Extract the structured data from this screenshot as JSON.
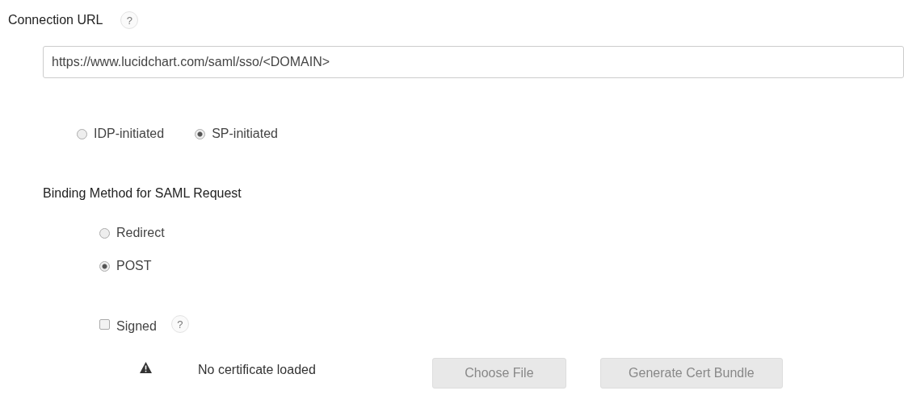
{
  "connection_url": {
    "label": "Connection URL",
    "help": "?",
    "value": "https://www.lucidchart.com/saml/sso/<DOMAIN>"
  },
  "initiation": [
    {
      "label": "IDP-initiated",
      "selected": false
    },
    {
      "label": "SP-initiated",
      "selected": true
    }
  ],
  "binding": {
    "label": "Binding Method for SAML Request",
    "options": [
      {
        "label": "Redirect",
        "selected": false
      },
      {
        "label": "POST",
        "selected": true
      }
    ]
  },
  "signed": {
    "label": "Signed",
    "checked": false,
    "help": "?"
  },
  "certificate": {
    "status": "No certificate loaded",
    "buttons": [
      {
        "label": "Choose File",
        "disabled": true
      },
      {
        "label": "Generate Cert Bundle",
        "disabled": true
      }
    ]
  }
}
